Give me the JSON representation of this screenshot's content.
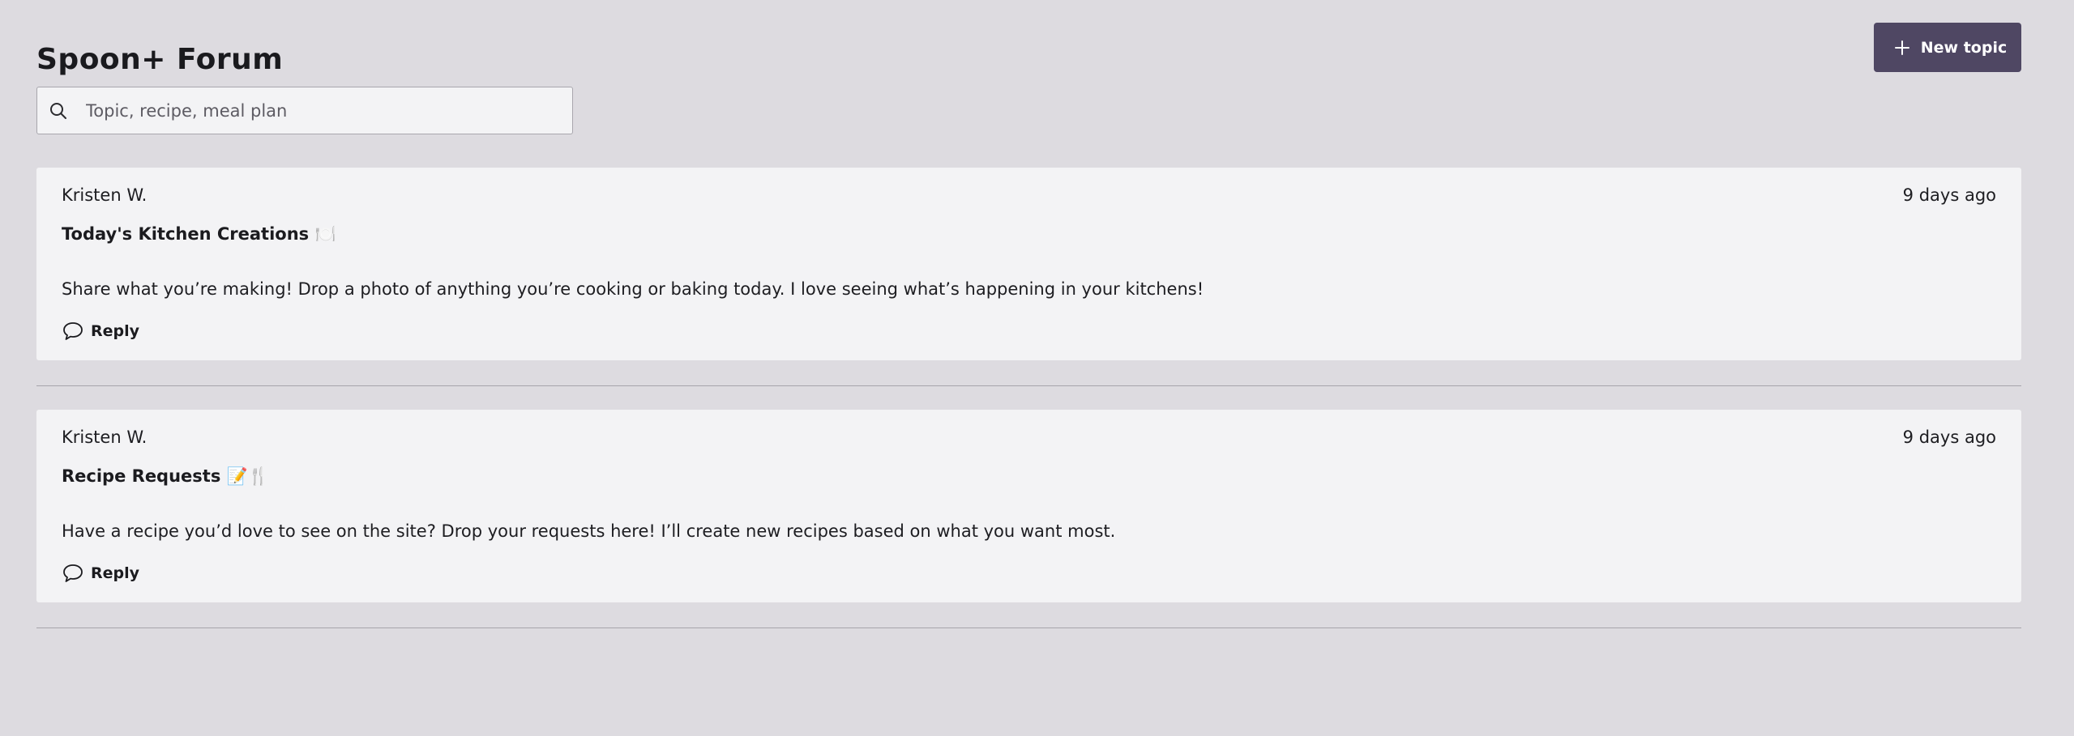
{
  "header": {
    "title": "Spoon+ Forum",
    "new_topic_label": "New topic"
  },
  "search": {
    "placeholder": "Topic, recipe, meal plan",
    "value": ""
  },
  "topics": [
    {
      "author": "Kristen W.",
      "time": "9 days ago",
      "title": "Today's Kitchen Creations 🍽️",
      "body": "Share what you’re making! Drop a photo of anything you’re cooking or baking today. I love seeing what’s happening in your kitchens!",
      "reply_label": "Reply"
    },
    {
      "author": "Kristen W.",
      "time": "9 days ago",
      "title": "Recipe Requests 📝🍴",
      "body": "Have a recipe you’d love to see on the site? Drop your requests here! I’ll create new recipes based on what you want most.",
      "reply_label": "Reply"
    }
  ],
  "colors": {
    "background": "#dddbe0",
    "card": "#f3f3f5",
    "accent": "#4f4763",
    "divider": "#a6a4ab"
  },
  "icons": {
    "new_topic": "plus-icon",
    "search": "search-icon",
    "reply": "comment-icon"
  }
}
